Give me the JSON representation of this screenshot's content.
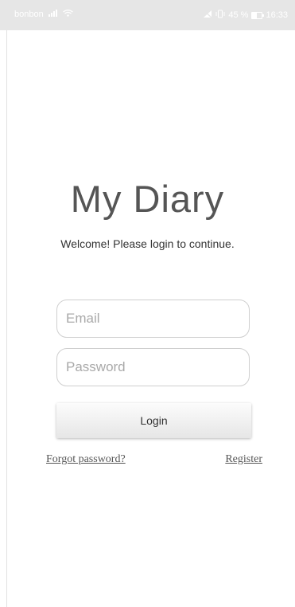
{
  "status_bar": {
    "carrier": "bonbon",
    "battery_percent": "45 %",
    "time": "16:33",
    "icons": [
      "signal-icon",
      "wifi-icon",
      "do-not-disturb-icon",
      "vibrate-icon",
      "battery-icon"
    ]
  },
  "login": {
    "title": "My Diary",
    "welcome": "Welcome! Please login to continue.",
    "email_placeholder": "Email",
    "email_value": "",
    "password_placeholder": "Password",
    "password_value": "",
    "login_label": "Login",
    "forgot_label": "Forgot password?",
    "register_label": "Register"
  }
}
